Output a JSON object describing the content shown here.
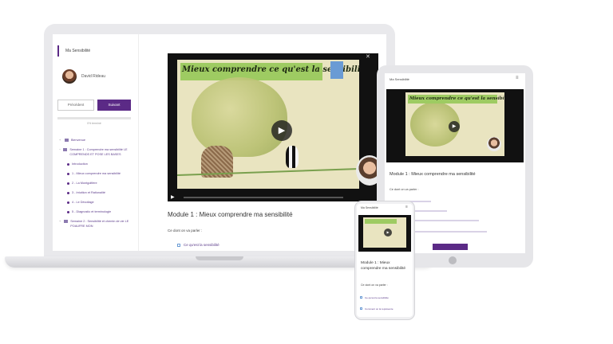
{
  "laptop": {
    "sidebar": {
      "title": "Ma Sensibilité",
      "user_name": "David Rideau",
      "prev_label": "Précédent",
      "next_label": "Suivant",
      "progress_text": "0% terminé",
      "items": [
        {
          "label": "Bienvenue",
          "level": 0
        },
        {
          "label": "Semaine 1 : Comprendre ma sensibilité LE COMPRENDS ET POSE LES BASES",
          "level": 0
        },
        {
          "label": "Introduction",
          "level": 1
        },
        {
          "label": "1 - Mieux comprendre ma sensibilité",
          "level": 1
        },
        {
          "label": "2 - La Montgolfière",
          "level": 1
        },
        {
          "label": "3 - Intuition et Rationalité",
          "level": 1
        },
        {
          "label": "4 - Le Décollage",
          "level": 1
        },
        {
          "label": "5 - Diagnostic et terminologie",
          "level": 1
        },
        {
          "label": "Semaine 2 : Sensibilité et chemin de vie LE POAUFRE MON",
          "level": 0
        }
      ]
    },
    "video": {
      "banner_text": "Mieux comprendre ce qu'est la sensibilité"
    },
    "module_title": "Module 1 : Mieux comprendre ma sensibilité",
    "intro": "Ce dont on va parler :",
    "bullet": "Ce qu'est la sensibilité"
  },
  "tablet": {
    "header": "Ma Sensibilité",
    "banner_text": "Mieux comprendre ce qu'est la sensibilité",
    "module_title": "Module 1 : Mieux comprendre ma sensibilité",
    "intro": "Ce dont on va parler :"
  },
  "phone": {
    "header": "Ma Sensibilité",
    "module_title": "Module 1 : Mieux comprendre ma sensibilité",
    "intro": "Ce dont on va parler :",
    "bullet1": "Ce qu'est la sensibilité",
    "bullet2": "Comment on la représente"
  },
  "colors": {
    "accent": "#5b2a86",
    "banner": "#9ecb62"
  }
}
